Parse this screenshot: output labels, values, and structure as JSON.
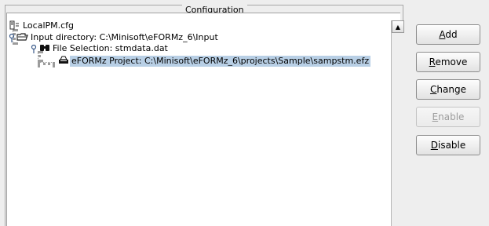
{
  "panel": {
    "title": "Configuration"
  },
  "tree": {
    "root": {
      "label": "LocalPM.cfg",
      "icon": "config-file-icon"
    },
    "input_directory": {
      "label": "Input directory: C:\\Minisoft\\eFORMz_6\\Input",
      "icon": "folder-open-icon"
    },
    "file_selection": {
      "label": "File Selection: stmdata.dat",
      "icon": "binoculars-icon"
    },
    "project": {
      "label": "eFORMz Project: C:\\Minisoft\\eFORMz_6\\projects\\Sample\\sampstm.efz",
      "icon": "printer-icon",
      "selected": true
    }
  },
  "buttons": {
    "add": {
      "first": "A",
      "rest": "dd"
    },
    "remove": {
      "first": "R",
      "rest": "emove"
    },
    "change": {
      "first": "C",
      "rest": "hange"
    },
    "enable": {
      "first": "E",
      "rest": "nable",
      "disabled": true
    },
    "disable": {
      "first": "D",
      "rest": "isable"
    }
  }
}
